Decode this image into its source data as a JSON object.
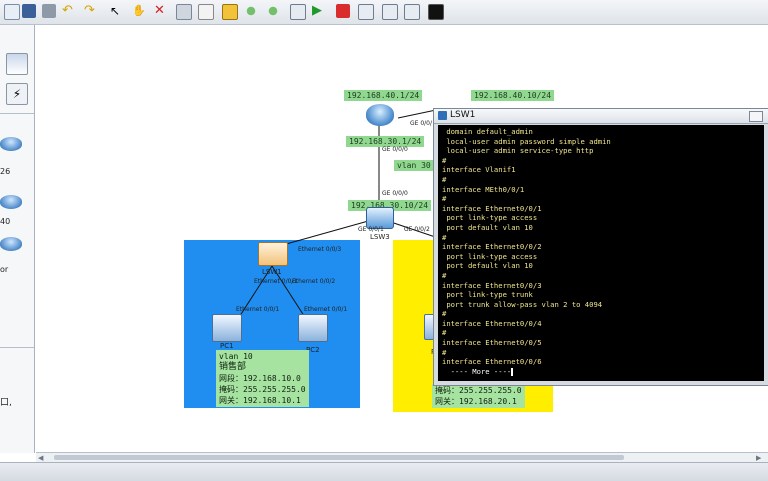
{
  "palette": {
    "items": [
      {
        "label": "26"
      },
      {
        "label": "40"
      },
      {
        "label": "or"
      }
    ],
    "left_note": "口,"
  },
  "topology": {
    "router_ip_left": "192.168.40.1/24",
    "router_ip_right": "192.168.40.10/24",
    "router_port_left_ip": "192.168.30.1/24",
    "router_port_top": "GE 0/0/",
    "router_port_down": "GE 0/0/0",
    "vlan_label": "vlan 30",
    "lsw3_port_up": "GE 0/0/0",
    "lsw3_ip": "192.168.30.10/24",
    "lsw3_port_left": "GE 0/0/1",
    "lsw3_port_right": "GE 0/0/2",
    "lsw3_name": "LSW3",
    "lsw1_name": "LSW1",
    "lsw1_port_up": "Ethernet 0/0/3",
    "lsw1_port_left": "Ethernet 0/0/1",
    "lsw1_port_right": "Ethernet 0/0/2",
    "pc1_port": "Ethernet 0/0/1",
    "pc2_port": "Ethernet 0/0/1",
    "pc1_name": "PC1",
    "pc2_name": "PC2",
    "pc_right_name": "P",
    "info_left": {
      "vlan": "vlan 10",
      "dept": "销售部",
      "ip": "网段：192.168.10.0",
      "mask": "掩码：255.255.255.0",
      "gw": "网关：192.168.10.1"
    },
    "info_right": {
      "mask": "掩码：255.255.255.0",
      "gw": "网关：192.168.20.1"
    },
    "colors": {
      "blue_zone": "#1f8ef0",
      "yellow_zone": "#ffee00",
      "ip_label_bg": "#90d890"
    }
  },
  "terminal": {
    "title": "LSW1",
    "lines": [
      " domain default_admin",
      " local-user admin password simple admin",
      " local-user admin service-type http",
      "#",
      "interface Vlanif1",
      "#",
      "interface MEth0/0/1",
      "#",
      "interface Ethernet0/0/1",
      " port link-type access",
      " port default vlan 10",
      "#",
      "interface Ethernet0/0/2",
      " port link-type access",
      " port default vlan 10",
      "#",
      "interface Ethernet0/0/3",
      " port link-type trunk",
      " port trunk allow-pass vlan 2 to 4094",
      "#",
      "interface Ethernet0/0/4",
      "#",
      "interface Ethernet0/0/5",
      "#",
      "interface Ethernet0/0/6"
    ],
    "more": "  ---- More ----"
  }
}
